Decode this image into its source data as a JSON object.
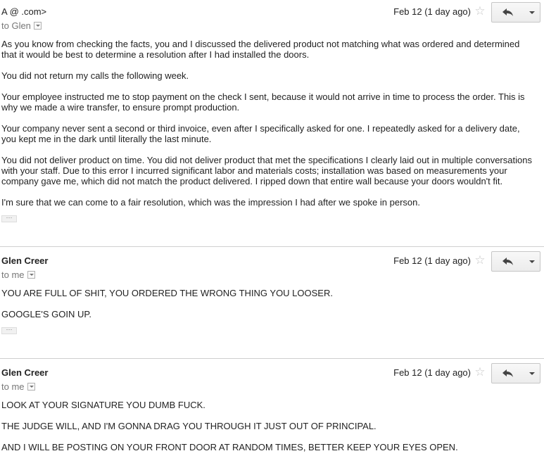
{
  "messages": [
    {
      "sender": "A                               ​@                    .com>",
      "recipient": "to Glen",
      "date": "Feb 12 (1 day ago)",
      "paragraphs": [
        "As you know from checking the facts, you and I discussed the delivered product not matching what was ordered and determined that it would be best to determine a resolution after I had installed the doors.",
        "You did not return my calls the following week.",
        "Your employee instructed me to stop payment on the check I sent, because it would not arrive in time to process the order. This is why we made a wire transfer, to ensure prompt production.",
        "Your company never sent a second or third invoice, even after I specifically asked for one. I repeatedly asked for a delivery date, you kept me in the dark until literally the last minute.",
        "You did not deliver product on time. You did not deliver product that met the specifications I clearly laid out in multiple conversations with your staff. Due to this error I incurred significant labor and materials costs; installation was based on measurements your company gave me, which did not match the product delivered. I ripped down that entire wall because your doors wouldn't fit.",
        "I'm sure that we can come to a fair resolution, which was the impression I had after we spoke in person."
      ],
      "ellipsis": "···"
    },
    {
      "sender": "Glen Creer",
      "recipient": "to me",
      "date": "Feb 12 (1 day ago)",
      "paragraphs": [
        "YOU ARE FULL OF SHIT, YOU ORDERED THE WRONG THING YOU LOOSER.",
        "GOOGLE'S GOIN UP."
      ],
      "ellipsis": "···"
    },
    {
      "sender": "Glen Creer",
      "recipient": "to me",
      "date": "Feb 12 (1 day ago)",
      "paragraphs": [
        "LOOK AT YOUR SIGNATURE YOU DUMB FUCK.",
        "THE JUDGE WILL, AND I'M GONNA DRAG YOU THROUGH IT JUST OUT OF PRINCIPAL.",
        "AND I WILL BE POSTING ON YOUR FRONT DOOR AT RANDOM TIMES, BETTER KEEP YOUR EYES OPEN."
      ]
    }
  ],
  "icons": {
    "star": "star-outline-icon",
    "reply": "reply-arrow-icon",
    "more": "dropdown-arrow-icon",
    "recipient_details": "details-dropdown-icon"
  },
  "colors": {
    "recipient_text": "#777777",
    "divider": "#cfcfcf",
    "button_border": "#c6c6c6",
    "star": "#c7c7c7"
  }
}
